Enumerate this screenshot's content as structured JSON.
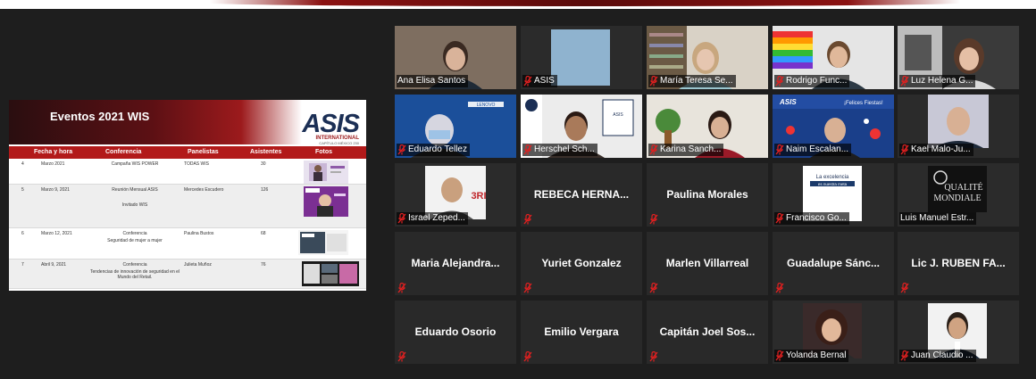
{
  "shared_screen": {
    "title": "Eventos 2021 WIS",
    "logo_text": "ASIS",
    "logo_sub": "INTERNATIONAL",
    "logo_sub2": "CAPÍTULO MÉXICO 230",
    "columns": [
      "Fecha y hora",
      "Conferencia",
      "Panelistas",
      "Asistentes",
      "Fotos"
    ],
    "rows": [
      {
        "num": "4",
        "date": "Marzo 2021",
        "conf": "Campaña WIS POWER",
        "conf2": "",
        "panel": "TODAS WIS",
        "asist": "30"
      },
      {
        "num": "5",
        "date": "Marzo 9, 2021",
        "conf": "Reunión Mensual ASIS",
        "conf2": "Invitado WIS",
        "panel": "Mercedes Escudero",
        "asist": "126"
      },
      {
        "num": "6",
        "date": "Marzo 12, 2021",
        "conf": "Conferencia",
        "conf2": "Seguridad de mujer a mujer",
        "panel": "Paulina Bustos",
        "asist": "68"
      },
      {
        "num": "7",
        "date": "Abril 9, 2021",
        "conf": "Conferencia",
        "conf2": "Tendencias de innovación de seguridad en el Mundo del Retail.",
        "panel": "Julieta Muñoz",
        "asist": "76"
      }
    ]
  },
  "participants": [
    {
      "name": "Ana Elisa Santos",
      "muted": false,
      "video": true
    },
    {
      "name": "ASIS",
      "muted": true,
      "video": true
    },
    {
      "name": "María Teresa Se...",
      "muted": true,
      "video": true
    },
    {
      "name": "Rodrigo Func...",
      "muted": true,
      "video": true
    },
    {
      "name": "Luz Helena G...",
      "muted": true,
      "video": true
    },
    {
      "name": "Eduardo Tellez",
      "muted": true,
      "video": true
    },
    {
      "name": "Herschel Sch...",
      "muted": true,
      "video": true
    },
    {
      "name": "Karina Sanch...",
      "muted": true,
      "video": true
    },
    {
      "name": "Naim Escalan...",
      "muted": true,
      "video": true
    },
    {
      "name": "Kael Malo-Ju...",
      "muted": true,
      "video": true
    },
    {
      "name": "Israel Zeped...",
      "muted": true,
      "video": true
    },
    {
      "name": "REBECA  HERNA...",
      "muted": true,
      "video": false
    },
    {
      "name": "Paulina Morales",
      "muted": true,
      "video": false
    },
    {
      "name": "Francisco Go...",
      "muted": true,
      "video": true
    },
    {
      "name": "Luis Manuel Estr...",
      "muted": false,
      "video": true
    },
    {
      "name": "Maria  Alejandra...",
      "muted": true,
      "video": false
    },
    {
      "name": "Yuriet Gonzalez",
      "muted": true,
      "video": false
    },
    {
      "name": "Marlen Villarreal",
      "muted": true,
      "video": false
    },
    {
      "name": "Guadalupe  Sánc...",
      "muted": true,
      "video": false
    },
    {
      "name": "Lic J.  RUBEN FA...",
      "muted": true,
      "video": false
    },
    {
      "name": "Eduardo Osorio",
      "muted": true,
      "video": false
    },
    {
      "name": "Emilio Vergara",
      "muted": true,
      "video": false
    },
    {
      "name": "Capitán  Joel  Sos...",
      "muted": true,
      "video": false
    },
    {
      "name": "Yolanda Bernal",
      "muted": true,
      "video": true
    },
    {
      "name": "Juan Claudio ...",
      "muted": true,
      "video": true
    }
  ],
  "thumb_texts": {
    "gen_badge": "GEN",
    "felices": "¡Felices Fiestas!",
    "excelencia": "La excelencia",
    "meta": "es nuestra meta",
    "qualite": "QUALITÉ",
    "mondiale": "MONDIALE",
    "lenovo": "LENOVO",
    "jrb": "3RI",
    "asis_small": "ASIS"
  },
  "colors": {
    "active_border": "#c6d64a",
    "muted_icon": "#e02020",
    "tile_bg": "#292929",
    "brand_red": "#b21a1a"
  }
}
